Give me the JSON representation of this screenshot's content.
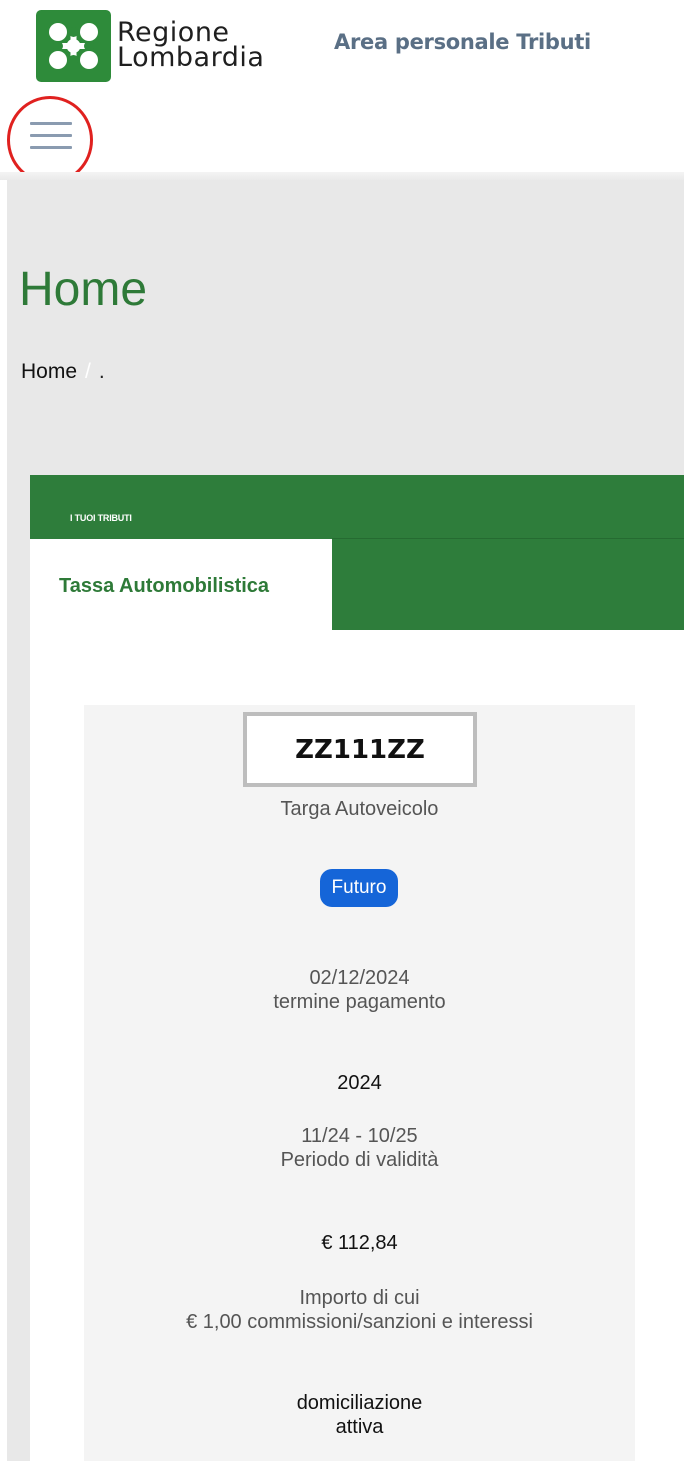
{
  "header": {
    "brand_line1": "Regione",
    "brand_line2": "Lombardia",
    "area_title": "Area personale Tributi",
    "logo_color": "#2e8b3a"
  },
  "icons": {
    "menu": "hamburger-menu-icon",
    "logo": "regione-lombardia-logo"
  },
  "page": {
    "title": "Home",
    "breadcrumb": {
      "home": "Home",
      "separator": "/",
      "current": "."
    }
  },
  "panel": {
    "kicker": "I TUOI TRIBUTI",
    "active_tab": "Tassa Automobilistica",
    "header_color": "#2e7d3b"
  },
  "card": {
    "plate": "ZZ111ZZ",
    "plate_label": "Targa Autoveicolo",
    "status_badge": "Futuro",
    "status_color": "#1565d8",
    "due_date": "02/12/2024",
    "due_date_label": "termine pagamento",
    "year": "2024",
    "validity_period": "11/24 - 10/25",
    "validity_label": "Periodo di validità",
    "amount": "€  112,84",
    "amount_label": "Importo di cui",
    "amount_detail": "€  1,00 commissioni/sanzioni e interessi",
    "direct_debit_line1": "domiciliazione",
    "direct_debit_line2": "attiva"
  },
  "annotations": {
    "highlight_color": "#e0211f"
  }
}
